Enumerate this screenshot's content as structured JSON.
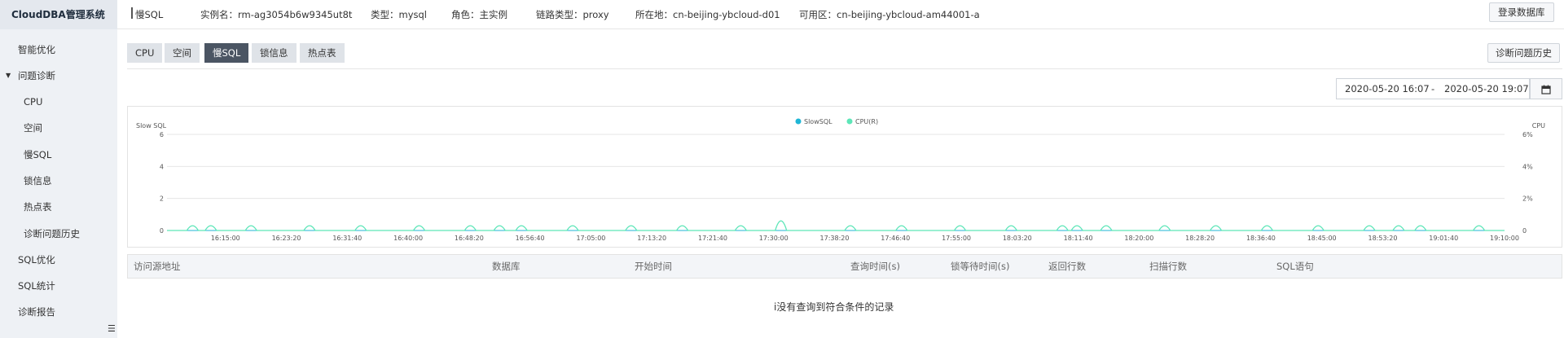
{
  "app": {
    "title": "CloudDBA管理系统"
  },
  "sidebar": {
    "items": [
      {
        "label": "智能优化"
      },
      {
        "label": "问题诊断"
      },
      {
        "label": "CPU"
      },
      {
        "label": "空间"
      },
      {
        "label": "慢SQL"
      },
      {
        "label": "锁信息"
      },
      {
        "label": "热点表"
      },
      {
        "label": "诊断问题历史"
      },
      {
        "label": "SQL优化"
      },
      {
        "label": "SQL统计"
      },
      {
        "label": "诊断报告"
      }
    ]
  },
  "header": {
    "page_title": "慢SQL",
    "instance": "实例名：rm-ag3054b6w9345ut8t",
    "type": "类型：mysql",
    "role": "角色：主实例",
    "link_type": "链路类型：proxy",
    "location": "所在地：cn-beijing-ybcloud-d01",
    "zone": "可用区：cn-beijing-ybcloud-am44001-a",
    "login_button": "登录数据库"
  },
  "tabs": [
    {
      "label": "CPU"
    },
    {
      "label": "空间"
    },
    {
      "label": "慢SQL",
      "active": true
    },
    {
      "label": "锁信息"
    },
    {
      "label": "热点表"
    }
  ],
  "history_button": "诊断问题历史",
  "date_range": {
    "start": "2020-05-20 16:07",
    "separator": "-",
    "end": "2020-05-20 19:07"
  },
  "icons": {
    "calendar": "calendar-icon",
    "collapse": "menu-collapse-icon",
    "info": "info-icon"
  },
  "colors": {
    "slowsql": "#1fb6d6",
    "cpu": "#5de6b8",
    "active_tab": "#4b5563"
  },
  "chart_data": {
    "type": "line",
    "ylabel_left": "Slow SQL",
    "ylabel_right": "CPU",
    "y_ticks_left": [
      "6",
      "4",
      "2",
      "0"
    ],
    "y_ticks_right": [
      "6%",
      "4%",
      "2%",
      "0"
    ],
    "ylim_left": [
      0,
      6
    ],
    "ylim_right": [
      0,
      6
    ],
    "x_ticks": [
      "16:15:00",
      "16:23:20",
      "16:31:40",
      "16:40:00",
      "16:48:20",
      "16:56:40",
      "17:05:00",
      "17:13:20",
      "17:21:40",
      "17:30:00",
      "17:38:20",
      "17:46:40",
      "17:55:00",
      "18:03:20",
      "18:11:40",
      "18:20:00",
      "18:28:20",
      "18:36:40",
      "18:45:00",
      "18:53:20",
      "19:01:40",
      "19:10:00"
    ],
    "legend": [
      "SlowSQL",
      "CPU(R)"
    ],
    "legend_position": "top-center",
    "series": [
      {
        "name": "SlowSQL",
        "values": [
          0,
          0,
          0,
          0,
          0,
          0,
          0,
          0,
          0,
          0,
          0,
          0,
          0,
          0,
          0,
          0,
          0,
          0,
          0,
          0,
          0,
          0
        ]
      },
      {
        "name": "CPU(R)",
        "spike_times": [
          "16:10:30",
          "16:13:00",
          "16:18:30",
          "16:26:30",
          "16:33:30",
          "16:41:30",
          "16:48:30",
          "16:52:30",
          "16:55:30",
          "17:02:30",
          "17:10:30",
          "17:17:30",
          "17:25:30",
          "17:31:00",
          "17:40:30",
          "17:47:30",
          "17:55:30",
          "18:02:30",
          "18:09:30",
          "18:11:30",
          "18:15:30",
          "18:23:30",
          "18:30:30",
          "18:37:30",
          "18:44:30",
          "18:51:30",
          "18:55:30",
          "18:58:30",
          "19:06:30"
        ],
        "spike_values": [
          0.3,
          0.3,
          0.3,
          0.3,
          0.3,
          0.3,
          0.3,
          0.3,
          0.3,
          0.3,
          0.3,
          0.3,
          0.3,
          0.6,
          0.3,
          0.3,
          0.3,
          0.3,
          0.3,
          0.3,
          0.3,
          0.3,
          0.3,
          0.3,
          0.3,
          0.3,
          0.3,
          0.3,
          0.3
        ],
        "baseline": 0
      }
    ]
  },
  "table": {
    "columns": [
      "访问源地址",
      "数据库",
      "开始时间",
      "查询时间(s)",
      "锁等待时间(s)",
      "返回行数",
      "扫描行数",
      "SQL语句"
    ],
    "empty_text": "没有查询到符合条件的记录"
  }
}
